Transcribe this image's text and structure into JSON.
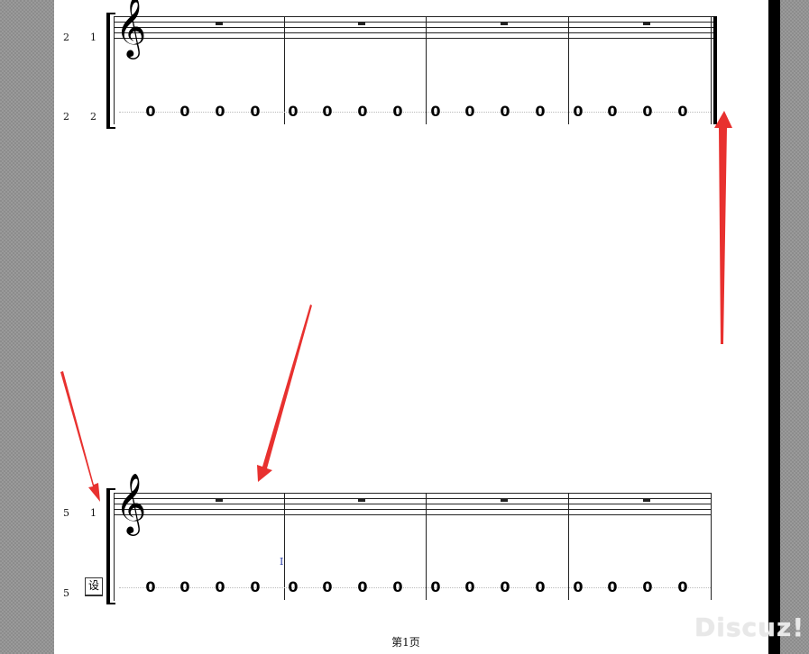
{
  "systems": [
    {
      "id": "system-1",
      "staff_labels": [
        {
          "row": "top",
          "col1": "2",
          "col2": "1"
        },
        {
          "row": "bottom",
          "col1": "2",
          "col2": "2"
        }
      ],
      "measures": [
        {
          "rest": "whole",
          "numbers": [
            "0",
            "0",
            "0",
            "0"
          ]
        },
        {
          "rest": "whole",
          "numbers": [
            "0",
            "0",
            "0",
            "0"
          ]
        },
        {
          "rest": "whole",
          "numbers": [
            "0",
            "0",
            "0",
            "0"
          ]
        },
        {
          "rest": "whole",
          "numbers": [
            "0",
            "0",
            "0",
            "0"
          ]
        }
      ],
      "final_barline": true
    },
    {
      "id": "system-2",
      "staff_labels": [
        {
          "row": "top",
          "col1": "5",
          "col2": "1"
        },
        {
          "row": "bottom",
          "col1": "5",
          "col2": ""
        }
      ],
      "measures": [
        {
          "rest": "whole",
          "numbers": [
            "0",
            "0",
            "0",
            "0"
          ]
        },
        {
          "rest": "whole",
          "numbers": [
            "0",
            "0",
            "0",
            "0"
          ]
        },
        {
          "rest": "whole",
          "numbers": [
            "0",
            "0",
            "0",
            "0"
          ]
        },
        {
          "rest": "whole",
          "numbers": [
            "0",
            "0",
            "0",
            "0"
          ]
        }
      ],
      "final_barline": false
    }
  ],
  "set_button": {
    "label": "设"
  },
  "cursor_text": "I",
  "footer": {
    "page_label": "第1页"
  },
  "watermark": "Discuz!",
  "colors": {
    "arrow": "#e8312f",
    "cursor": "#2b3fa6",
    "page": "#ffffff"
  }
}
